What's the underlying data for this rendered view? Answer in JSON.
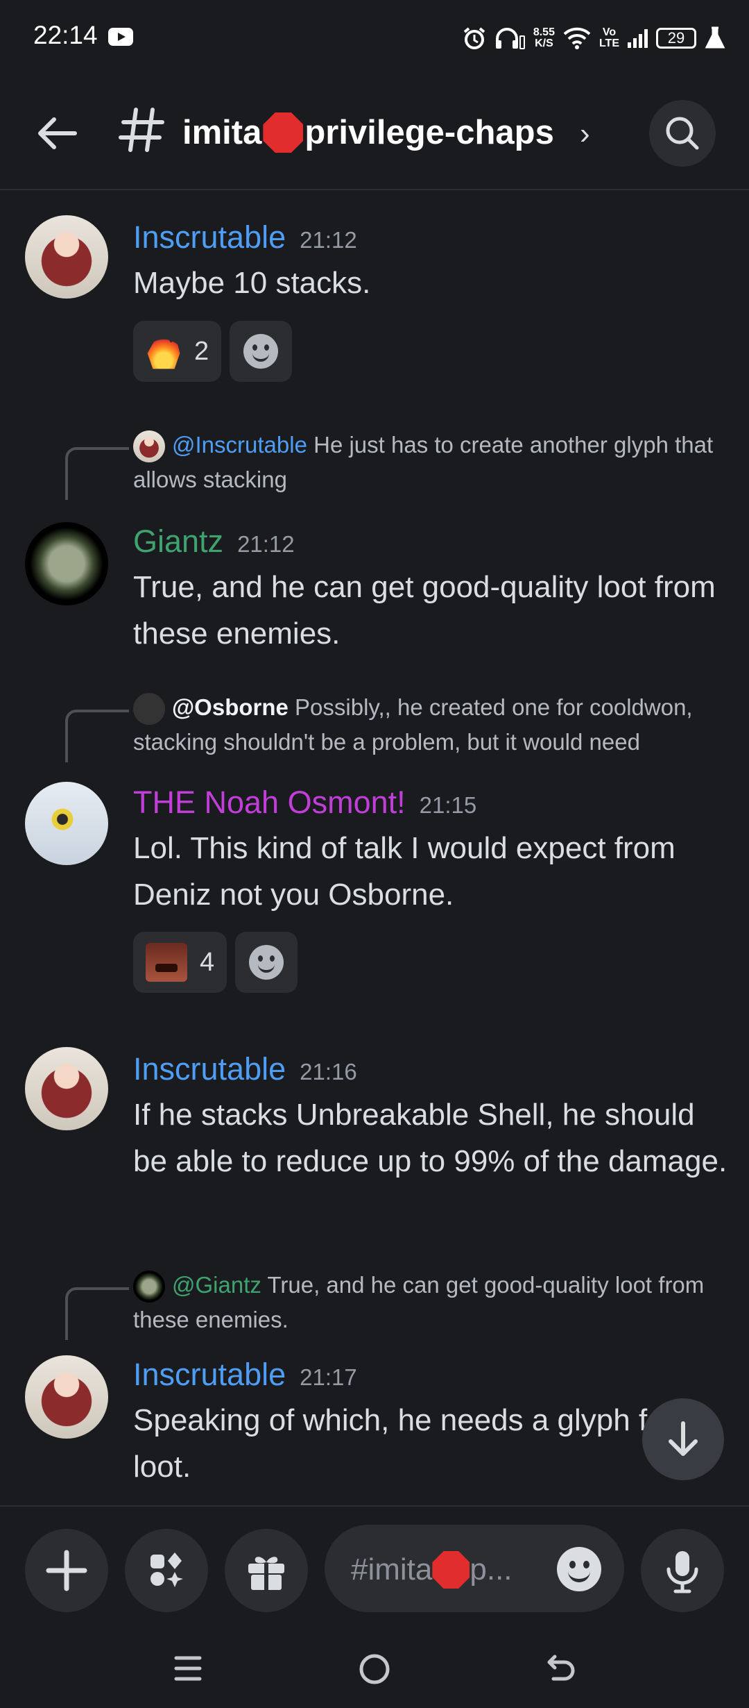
{
  "status_bar": {
    "time": "22:14",
    "net_speed_value": "8.55",
    "net_speed_unit": "K/S",
    "volte_top": "Vo",
    "volte_bottom": "LTE",
    "battery": "29"
  },
  "header": {
    "channel_prefix": "imita",
    "channel_suffix": "privilege-chaps"
  },
  "messages": [
    {
      "author": "Inscrutable",
      "author_color": "#4e9ef5",
      "time": "21:12",
      "text": "Maybe 10 stacks.",
      "reaction_count": "2"
    },
    {
      "reply_to": "@Inscrutable",
      "reply_text": "He just has to create another glyph that allows stacking",
      "author": "Giantz",
      "author_color": "#3ea36f",
      "time": "21:12",
      "text": "True, and he can get good-quality loot from these enemies."
    },
    {
      "reply_to": "@Osborne",
      "reply_text": "Possibly,, he created one for cooldwon, stacking shouldn't be a problem, but it would need",
      "author": "THE Noah Osmont!",
      "author_color": "#c13fd8",
      "time": "21:15",
      "text": "Lol. This kind of talk I would expect from Deniz not you Osborne.",
      "reaction_count": "4"
    },
    {
      "author": "Inscrutable",
      "author_color": "#4e9ef5",
      "time": "21:16",
      "text": "If he stacks Unbreakable Shell, he should be able to reduce up to 99% of the damage."
    },
    {
      "reply_to": "@Giantz",
      "reply_text": "True, and he can get good-quality loot from these enemies.",
      "author": "Inscrutable",
      "author_color": "#4e9ef5",
      "time": "21:17",
      "text": "Speaking of which, he needs a glyph for loot."
    }
  ],
  "composer": {
    "placeholder_prefix": "#imita",
    "placeholder_suffix": "p..."
  }
}
